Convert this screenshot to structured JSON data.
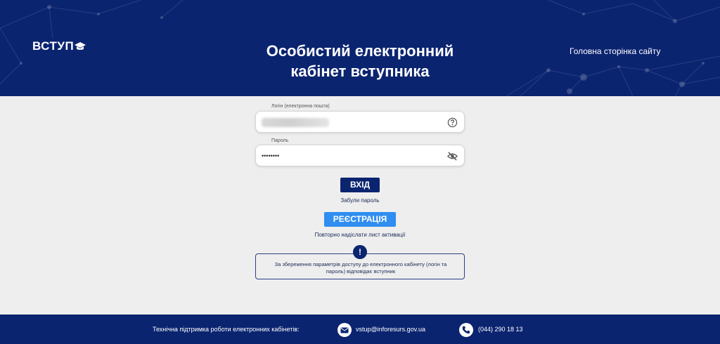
{
  "header": {
    "logo_text": "ВСТУП",
    "title_line1": "Особистий електронний",
    "title_line2": "кабінет вступника",
    "home_link": "Головна сторінка сайту"
  },
  "form": {
    "login_label": "Логін (електронна пошта)",
    "login_value": "",
    "password_label": "Пароль",
    "password_value": "••••••••",
    "login_button": "ВХІД",
    "forgot_link": "Забули пароль",
    "register_button": "РЕЄСТРАЦІЯ",
    "resend_link": "Повторно надіслати лист активації"
  },
  "notice": {
    "badge": "!",
    "text": "За збереження параметрів доступу до електронного кабінету (логін та пароль) відповідає вступник"
  },
  "footer": {
    "support_text": "Технічна підтримка роботи електронних кабінетів:",
    "email": "vstup@inforesurs.gov.ua",
    "phone": "(044) 290 18 13"
  },
  "icons": {
    "help": "help-circle-icon",
    "visibility": "eye-off-icon",
    "email": "envelope-icon",
    "phone": "phone-icon"
  },
  "colors": {
    "header_bg": "#0b2470",
    "register_bg": "#2f8ef0",
    "page_bg": "#eeeeee"
  }
}
